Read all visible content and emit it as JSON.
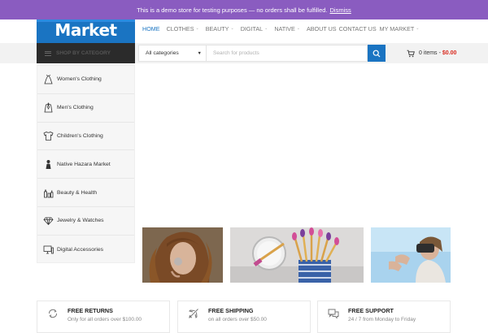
{
  "notice": {
    "text": "This is a demo store for testing purposes — no orders shall be fulfilled.",
    "dismiss": "Dismiss"
  },
  "logo": {
    "text": "Market"
  },
  "nav": [
    {
      "label": "HOME",
      "active": true,
      "caret": false
    },
    {
      "label": "CLOTHES",
      "caret": true
    },
    {
      "label": "BEAUTY",
      "caret": true
    },
    {
      "label": "DIGITAL",
      "caret": true
    },
    {
      "label": "NATIVE",
      "caret": true
    },
    {
      "label": "ABOUT US",
      "caret": false
    },
    {
      "label": "CONTACT US",
      "caret": false
    },
    {
      "label": "MY MARKET",
      "caret": true
    }
  ],
  "shop_by_category": "SHOP BY CATEGORY",
  "search": {
    "category": "All categories",
    "placeholder": "Search for products"
  },
  "cart": {
    "items": "0 items",
    "dash": "-",
    "total": "$0.00"
  },
  "categories": [
    {
      "label": "Women's Clothing",
      "icon": "dress-icon"
    },
    {
      "label": "Men's Clothing",
      "icon": "suit-icon"
    },
    {
      "label": "Children's Clothing",
      "icon": "kids-shirt-icon"
    },
    {
      "label": "Native Hazara Market",
      "icon": "native-figure-icon"
    },
    {
      "label": "Beauty & Health",
      "icon": "cosmetics-icon"
    },
    {
      "label": "Jewelry & Watches",
      "icon": "diamond-icon"
    },
    {
      "label": "Digital Accessories",
      "icon": "computer-icon"
    }
  ],
  "features": [
    {
      "title": "FREE RETURNS",
      "desc": "Only for all orders over $100.00",
      "icon": "returns-icon"
    },
    {
      "title": "FREE SHIPPING",
      "desc": "on all orders over $50.00",
      "icon": "plane-icon"
    },
    {
      "title": "FREE SUPPORT",
      "desc": "24 / 7 from Monday to Friday",
      "icon": "chat-icon"
    }
  ],
  "colors": {
    "notice_bg": "#8a5cc0",
    "brand_blue": "#1a74c2",
    "price_red": "#d8281d"
  }
}
